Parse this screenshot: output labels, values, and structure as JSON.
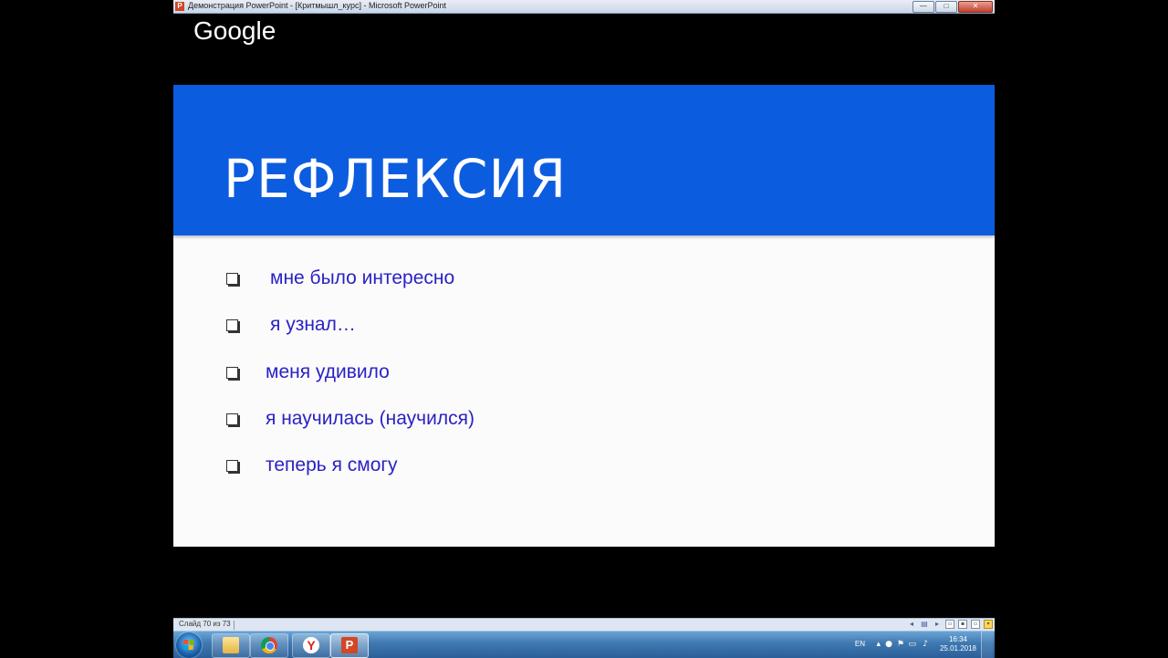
{
  "window": {
    "title": "Демонстрация PowerPoint - [Критмышл_курс] - Microsoft PowerPoint",
    "app_icon": "P",
    "buttons": {
      "minimize": "—",
      "maximize": "□",
      "close": "✕"
    }
  },
  "overlay": {
    "logo": "Google"
  },
  "slide": {
    "title": "РЕФЛЕКСИЯ",
    "header_color": "#0c5cdf",
    "text_color": "#2a22c4",
    "bullets": [
      "мне было интересно",
      "я узнал…",
      "меня удивило",
      "я научилась (научился)",
      "теперь я смогу"
    ]
  },
  "statusbar": {
    "slide_count": "Слайд 70 из 73",
    "icons": [
      "prev-icon",
      "notes-icon",
      "next-icon",
      "normal-view-icon",
      "sorter-view-icon",
      "reading-view-icon",
      "slideshow-view-icon"
    ]
  },
  "taskbar": {
    "apps": [
      "windows-explorer",
      "google-chrome",
      "yandex-browser",
      "powerpoint"
    ],
    "yandex_glyph": "Y",
    "powerpoint_glyph": "P"
  },
  "tray": {
    "language": "EN",
    "time": "16:34",
    "date": "25.01.2018"
  }
}
